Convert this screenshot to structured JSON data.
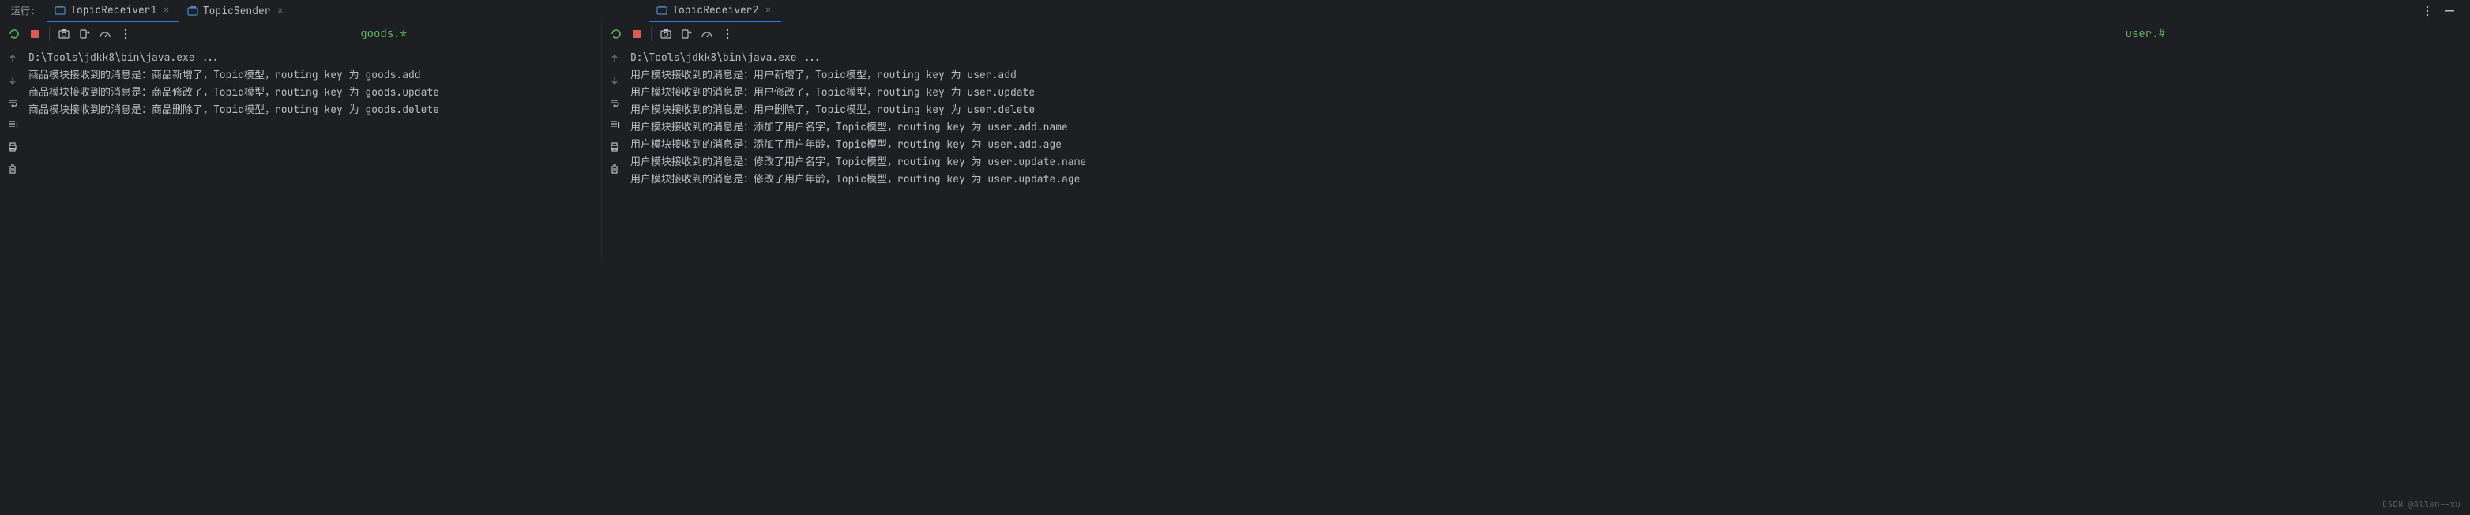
{
  "header": {
    "run_label": "运行:",
    "tabs": [
      {
        "label": "TopicReceiver1",
        "active": true
      },
      {
        "label": "TopicSender",
        "active": false
      }
    ],
    "right_tabs": [
      {
        "label": "TopicReceiver2",
        "active": true
      }
    ]
  },
  "overlay": {
    "left": "goods.*",
    "right": "user.#"
  },
  "left_panel": {
    "lines": [
      "D:\\Tools\\jdkk8\\bin\\java.exe ...",
      "商品模块接收到的消息是：商品新增了，Topic模型，routing key 为 goods.add",
      "商品模块接收到的消息是：商品修改了，Topic模型，routing key 为 goods.update",
      "商品模块接收到的消息是：商品删除了，Topic模型，routing key 为 goods.delete"
    ]
  },
  "right_panel": {
    "lines": [
      "D:\\Tools\\jdkk8\\bin\\java.exe ...",
      "用户模块接收到的消息是：用户新增了，Topic模型，routing key 为 user.add",
      "用户模块接收到的消息是：用户修改了，Topic模型，routing key 为 user.update",
      "用户模块接收到的消息是：用户删除了，Topic模型，routing key 为 user.delete",
      "用户模块接收到的消息是：添加了用户名字，Topic模型，routing key 为 user.add.name",
      "用户模块接收到的消息是：添加了用户年龄，Topic模型，routing key 为 user.add.age",
      "用户模块接收到的消息是：修改了用户名字，Topic模型，routing key 为 user.update.name",
      "用户模块接收到的消息是：修改了用户年龄，Topic模型，routing key 为 user.update.age"
    ]
  },
  "watermark": "CSDN @Allen--xu"
}
